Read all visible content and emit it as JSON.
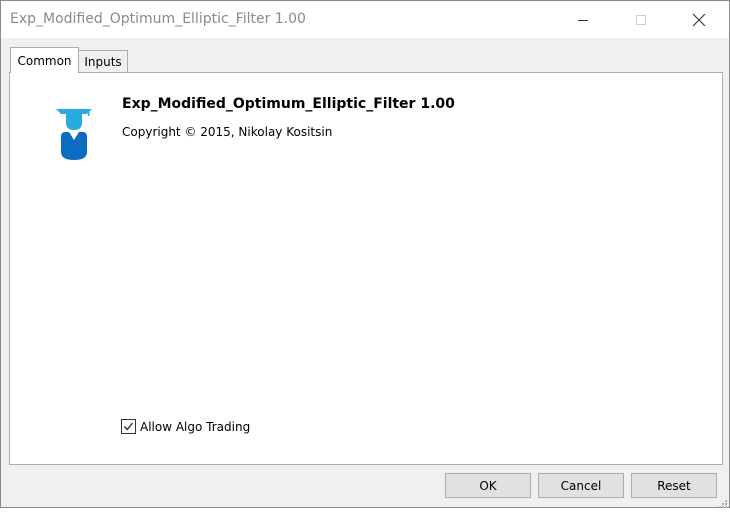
{
  "window": {
    "title": "Exp_Modified_Optimum_Elliptic_Filter 1.00"
  },
  "tabs": [
    {
      "label": "Common",
      "active": true
    },
    {
      "label": "Inputs",
      "active": false
    }
  ],
  "common": {
    "ea_name": "Exp_Modified_Optimum_Elliptic_Filter 1.00",
    "copyright": "Copyright © 2015, Nikolay Kositsin",
    "logo_icon": "graduate-icon",
    "allow_algo_trading": {
      "label": "Allow Algo Trading",
      "checked": true
    }
  },
  "buttons": {
    "ok": "OK",
    "cancel": "Cancel",
    "reset": "Reset"
  },
  "colors": {
    "logo_light": "#29abe2",
    "logo_dark": "#0b6cc0"
  }
}
